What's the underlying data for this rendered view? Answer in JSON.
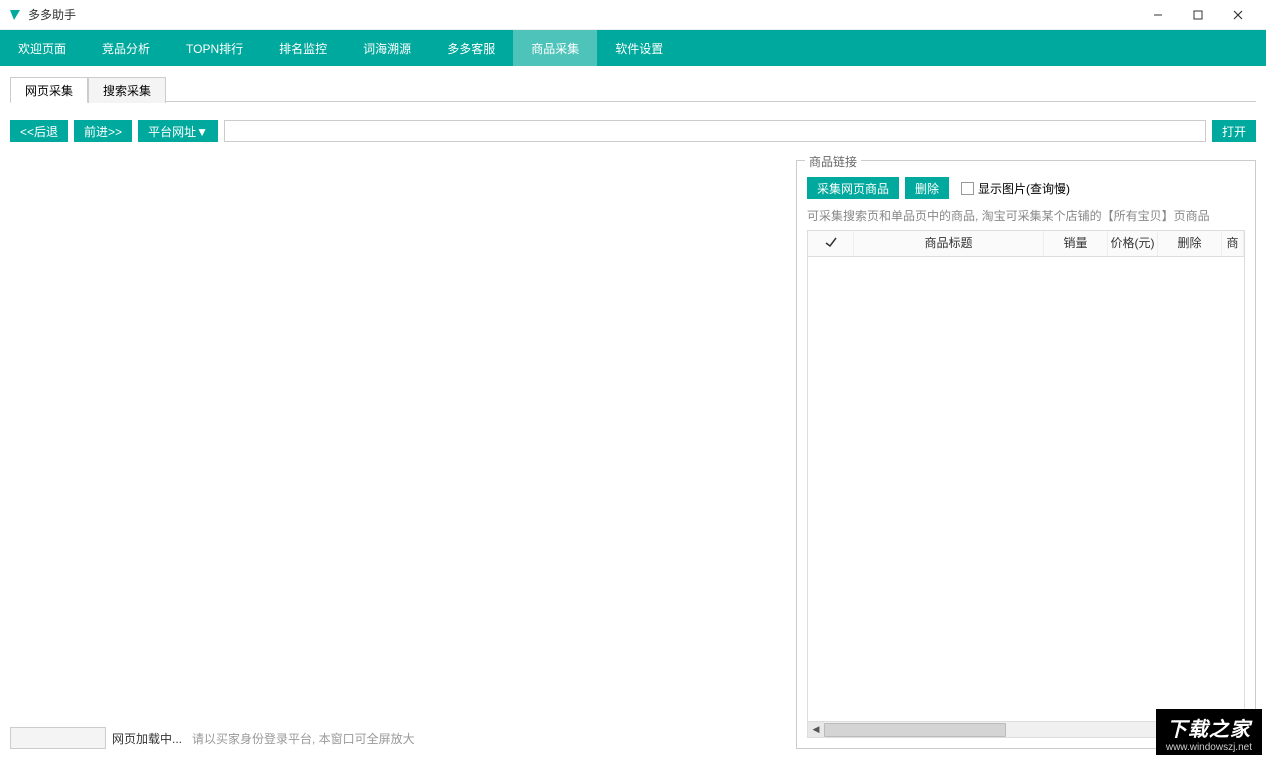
{
  "app": {
    "title": "多多助手"
  },
  "nav": {
    "items": [
      {
        "label": "欢迎页面",
        "active": false
      },
      {
        "label": "竞品分析",
        "active": false
      },
      {
        "label": "TOPN排行",
        "active": false
      },
      {
        "label": "排名监控",
        "active": false
      },
      {
        "label": "词海溯源",
        "active": false
      },
      {
        "label": "多多客服",
        "active": false
      },
      {
        "label": "商品采集",
        "active": true
      },
      {
        "label": "软件设置",
        "active": false
      }
    ]
  },
  "subtabs": {
    "items": [
      {
        "label": "网页采集",
        "active": true
      },
      {
        "label": "搜索采集",
        "active": false
      }
    ]
  },
  "toolbar": {
    "back": "<<后退",
    "forward": "前进>>",
    "platform": "平台网址▼",
    "url_value": "",
    "open": "打开"
  },
  "status": {
    "loading": "网页加载中...",
    "hint": "请以买家身份登录平台, 本窗口可全屏放大"
  },
  "panel": {
    "legend": "商品链接",
    "collect": "采集网页商品",
    "delete": "删除",
    "show_image": "显示图片(查询慢)",
    "info": "可采集搜索页和单品页中的商品, 淘宝可采集某个店铺的【所有宝贝】页商品",
    "columns": {
      "check": "check",
      "title": "商品标题",
      "sales": "销量",
      "price": "价格(元)",
      "delete": "删除",
      "extra": "商"
    }
  },
  "watermark": {
    "big": "下载之家",
    "small": "www.windowszj.net"
  }
}
